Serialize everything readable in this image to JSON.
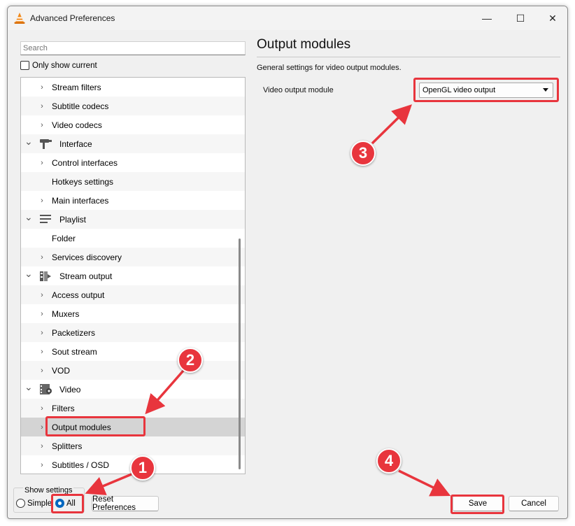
{
  "window": {
    "title": "Advanced Preferences",
    "controls": {
      "minimize": "—",
      "maximize": "☐",
      "close": "✕"
    }
  },
  "left_pane": {
    "search_placeholder": "Search",
    "only_show_current": "Only show current",
    "tree": [
      {
        "label": "Stream filters",
        "kind": "child",
        "chevron": "›"
      },
      {
        "label": "Subtitle codecs",
        "kind": "child",
        "chevron": "›"
      },
      {
        "label": "Video codecs",
        "kind": "child",
        "chevron": "›"
      },
      {
        "label": "Interface",
        "kind": "parent",
        "chevron": "⌄",
        "icon": "interface-icon"
      },
      {
        "label": "Control interfaces",
        "kind": "child",
        "chevron": "›"
      },
      {
        "label": "Hotkeys settings",
        "kind": "child",
        "chevron": ""
      },
      {
        "label": "Main interfaces",
        "kind": "child",
        "chevron": "›"
      },
      {
        "label": "Playlist",
        "kind": "parent",
        "chevron": "⌄",
        "icon": "playlist-icon"
      },
      {
        "label": "Folder",
        "kind": "child",
        "chevron": ""
      },
      {
        "label": "Services discovery",
        "kind": "child",
        "chevron": "›"
      },
      {
        "label": "Stream output",
        "kind": "parent",
        "chevron": "⌄",
        "icon": "stream-output-icon"
      },
      {
        "label": "Access output",
        "kind": "child",
        "chevron": "›"
      },
      {
        "label": "Muxers",
        "kind": "child",
        "chevron": "›"
      },
      {
        "label": "Packetizers",
        "kind": "child",
        "chevron": "›"
      },
      {
        "label": "Sout stream",
        "kind": "child",
        "chevron": "›"
      },
      {
        "label": "VOD",
        "kind": "child",
        "chevron": "›"
      },
      {
        "label": "Video",
        "kind": "parent",
        "chevron": "⌄",
        "icon": "video-icon"
      },
      {
        "label": "Filters",
        "kind": "child",
        "chevron": "›"
      },
      {
        "label": "Output modules",
        "kind": "child",
        "chevron": "›",
        "selected": true
      },
      {
        "label": "Splitters",
        "kind": "child",
        "chevron": "›"
      },
      {
        "label": "Subtitles / OSD",
        "kind": "child",
        "chevron": "›"
      }
    ],
    "show_settings": {
      "legend": "Show settings",
      "simple": "Simple",
      "all": "All",
      "selected": "All"
    },
    "reset_button": "Reset Preferences"
  },
  "right_pane": {
    "title": "Output modules",
    "description": "General settings for video output modules.",
    "video_output_label": "Video output module",
    "video_output_value": "OpenGL video output"
  },
  "footer": {
    "save": "Save",
    "cancel": "Cancel"
  },
  "annotations": {
    "accent_color": "#e8353d",
    "badges": [
      "1",
      "2",
      "3",
      "4"
    ]
  },
  "colors": {
    "window_bg": "#f0f0f0",
    "selected_row": "#d4d4d4",
    "radio_accent": "#0067c0"
  }
}
